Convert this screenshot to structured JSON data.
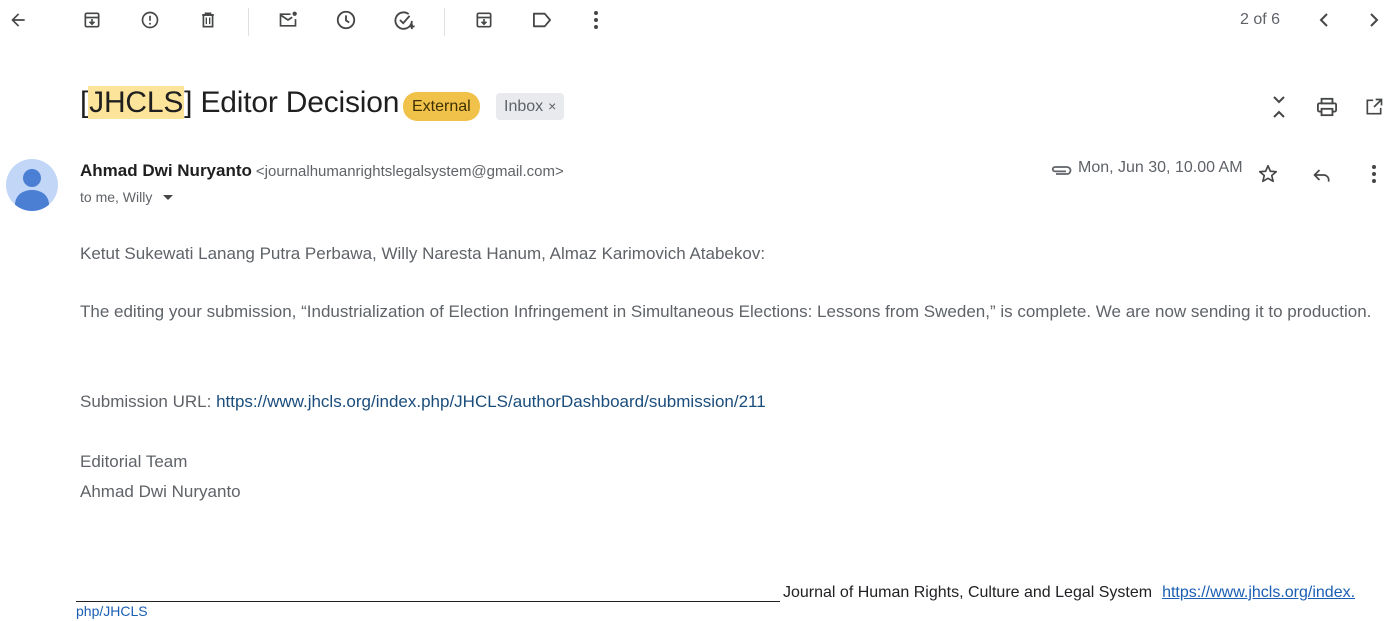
{
  "toolbar": {
    "icons": [
      "back-arrow-icon",
      "archive-icon",
      "report-spam-icon",
      "delete-icon",
      "mark-unread-icon",
      "snooze-icon",
      "add-to-tasks-icon",
      "move-to-icon",
      "label-icon",
      "more-vert-icon"
    ],
    "pager": "2 of 6"
  },
  "subject": {
    "highlight": "JHCLS",
    "open_bracket": "[",
    "rest": "] Editor Decision",
    "external_label": "External",
    "inbox_label": "Inbox",
    "inbox_remove": "×"
  },
  "message": {
    "sender_name": "Ahmad Dwi Nuryanto",
    "sender_email": "<journalhumanrightslegalsystem@gmail.com>",
    "recipients": "to me, Willy",
    "date": "Mon, Jun 30, 10.00 AM"
  },
  "body": {
    "greeting": "Ketut Sukewati Lanang Putra Perbawa, Willy Naresta Hanum, Almaz Karimovich Atabekov:",
    "paragraph": "The editing your submission, “Industrialization of Election Infringement in Simultaneous Elections: Lessons from Sweden,” is complete. We are now sending it to production.",
    "url_label": "Submission URL: ",
    "url": "https://www.jhcls.org/index.php/JHCLS/authorDashboard/submission/211",
    "signoff_1": "Editorial Team",
    "signoff_2": "Ahmad Dwi Nuryanto"
  },
  "footer": {
    "journal": "Journal of Human Rights, Culture and Legal System",
    "link_part1": "https://www.jhcls.org/index.",
    "link_part2": "php/JHCLS"
  },
  "colors": {
    "external_chip": "#f1c24a",
    "highlight": "#fce49a",
    "link": "#1a4d7c",
    "avatar_bg": "#c2d7f7",
    "avatar_fg": "#4a7fd4"
  }
}
